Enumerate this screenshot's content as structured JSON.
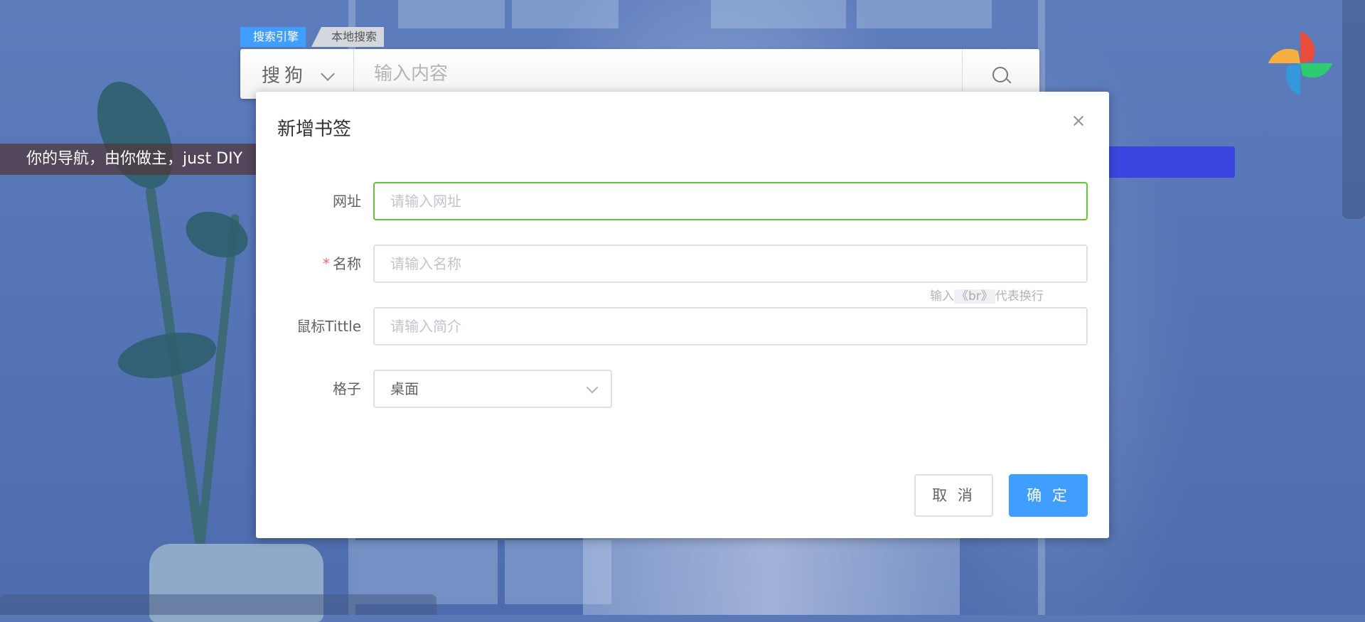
{
  "search": {
    "tabs": [
      {
        "label": "搜索引擎",
        "active": true
      },
      {
        "label": "本地搜索",
        "active": false
      }
    ],
    "engine": "搜狗",
    "placeholder": "输入内容"
  },
  "slogan": "你的导航，由你做主，just DIY",
  "dialog": {
    "title": "新增书签",
    "fields": {
      "url": {
        "label": "网址",
        "placeholder": "请输入网址"
      },
      "name": {
        "label": "名称",
        "required_mark": "*",
        "placeholder": "请输入名称"
      },
      "tooltip": {
        "label": "鼠标Tittle",
        "placeholder": "请输入简介",
        "hint_prefix": "输入",
        "hint_code": "《br》",
        "hint_suffix": "代表换行"
      },
      "grid": {
        "label": "格子",
        "value": "桌面"
      }
    },
    "buttons": {
      "cancel": "取 消",
      "ok": "确 定"
    }
  },
  "colors": {
    "primary": "#409eff",
    "focus_border": "#67c23a",
    "required": "#f56c6c",
    "blue_bar": "#3a45e0"
  }
}
